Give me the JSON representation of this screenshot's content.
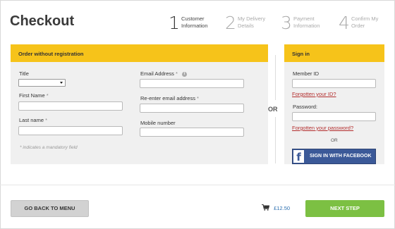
{
  "page": {
    "title": "Checkout"
  },
  "steps": [
    {
      "number": "1",
      "label_line1": "Customer",
      "label_line2": "Information",
      "state": "active"
    },
    {
      "number": "2",
      "label_line1": "My Delivery",
      "label_line2": "Details",
      "state": "inactive"
    },
    {
      "number": "3",
      "label_line1": "Payment",
      "label_line2": "Information",
      "state": "inactive"
    },
    {
      "number": "4",
      "label_line1": "Confirm My",
      "label_line2": "Order",
      "state": "inactive"
    }
  ],
  "guest": {
    "heading": "Order without registration",
    "title_label": "Title",
    "title_value": "",
    "first_name_label": "First Name",
    "last_name_label": "Last name",
    "email_label": "Email Address",
    "reemail_label": "Re-enter email address",
    "mobile_label": "Mobile number",
    "required_mark": "*",
    "info_icon": "i",
    "mandatory_note": "* indicates a mandatory field",
    "first_name_value": "",
    "last_name_value": "",
    "email_value": "",
    "reemail_value": "",
    "mobile_value": ""
  },
  "or_label": "OR",
  "signin": {
    "heading": "Sign in",
    "member_id_label": "Member ID",
    "member_id_value": "",
    "forgot_id_link": "Forgotten your ID?",
    "password_label": "Password:",
    "password_value": "",
    "forgot_password_link": "Forgotten your password?",
    "or_label": "OR",
    "facebook_letter": "f",
    "facebook_button": "SIGN IN WITH FACEBOOK"
  },
  "footer": {
    "back_button": "GO BACK TO MENU",
    "cart_total": "£12.50",
    "next_button": "NEXT STEP"
  },
  "colors": {
    "accent_yellow": "#f6c31a",
    "next_green": "#7cc043",
    "facebook_blue": "#3b5998",
    "link_red": "#b32d2d",
    "cart_blue": "#2c6fb0"
  },
  "icons": {
    "cart": "cart-icon",
    "info": "info-icon",
    "facebook": "facebook-icon",
    "dropdown": "chevron-down-icon"
  }
}
